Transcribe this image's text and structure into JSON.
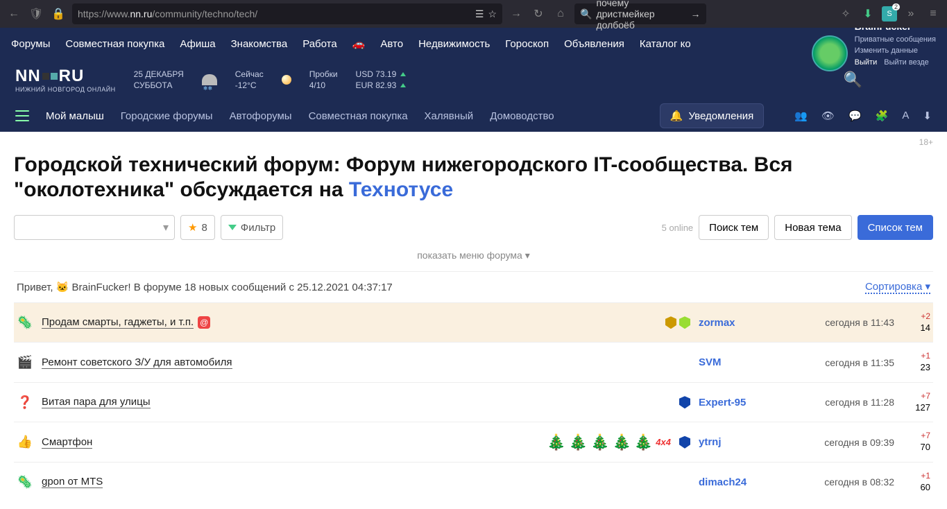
{
  "browser": {
    "url_prefix": "https://www.",
    "url_domain": "nn.ru",
    "url_path": "/community/techno/tech/",
    "search_query": "почему дристмейкер долбоёб",
    "ext_badge": "2"
  },
  "topnav": {
    "items": [
      "Форумы",
      "Совместная покупка",
      "Афиша",
      "Знакомства",
      "Работа",
      "Авто",
      "Недвижимость",
      "Гороскоп",
      "Объявления",
      "Каталог ко"
    ]
  },
  "user": {
    "name": "BrainFucker",
    "pm": "Приватные сообщения",
    "edit": "Изменить данные",
    "logout": "Выйти",
    "logout_all": "Выйти везде"
  },
  "header": {
    "date": "25 ДЕКАБРЯ",
    "weekday": "СУББОТА",
    "now_label": "Сейчас",
    "temp": "-12°C",
    "traffic_label": "Пробки",
    "traffic_val": "4/10",
    "usd": "USD 73.19",
    "eur": "EUR 82.93",
    "brand_sub": "НИЖНИЙ НОВГОРОД ОНЛАЙН"
  },
  "nav2": {
    "items": [
      "Мой малыш",
      "Городские форумы",
      "Автофорумы",
      "Совместная покупка",
      "Халявный",
      "Домоводство"
    ],
    "notif": "Уведомления"
  },
  "page": {
    "age": "18+",
    "title_pre": "Городской технический форум: Форум нижегородского IT-сообщества. Вся \"околотехника\" обсуждается на ",
    "title_link": "Технотусе",
    "fav_count": "8",
    "filter_label": "Фильтр",
    "online": "5 online",
    "btn_search": "Поиск тем",
    "btn_new": "Новая тема",
    "btn_list": "Список тем",
    "show_menu": "показать меню форума",
    "greet": "Привет, 🐱 BrainFucker! В форуме 18 новых сообщений с 25.12.2021 04:37:17",
    "sort": "Сортировка"
  },
  "threads": [
    {
      "icon": "🦠",
      "title": "Продам смарты, гаджеты, и т.п.",
      "at": true,
      "user": "zormax",
      "shields": [
        "y",
        "g"
      ],
      "time": "сегодня в 11:43",
      "vote": "+2",
      "count": "14",
      "hl": true
    },
    {
      "icon": "🎬",
      "title": "Ремонт советского З/У для автомобиля",
      "user": "SVM",
      "time": "сегодня в 11:35",
      "vote": "+1",
      "count": "23"
    },
    {
      "icon": "❓",
      "title": "Витая пара для улицы",
      "user": "Expert-95",
      "shields": [
        "b"
      ],
      "time": "сегодня в 11:28",
      "vote": "+7",
      "count": "127"
    },
    {
      "icon": "👍",
      "title": "Смартфон",
      "trees": 5,
      "x4": "4x4",
      "user": "ytrnj",
      "shields": [
        "b"
      ],
      "time": "сегодня в 09:39",
      "vote": "+7",
      "count": "70"
    },
    {
      "icon": "🦠",
      "title": "gpon от MTS",
      "user": "dimach24",
      "time": "сегодня в 08:32",
      "vote": "+1",
      "count": "60"
    }
  ]
}
